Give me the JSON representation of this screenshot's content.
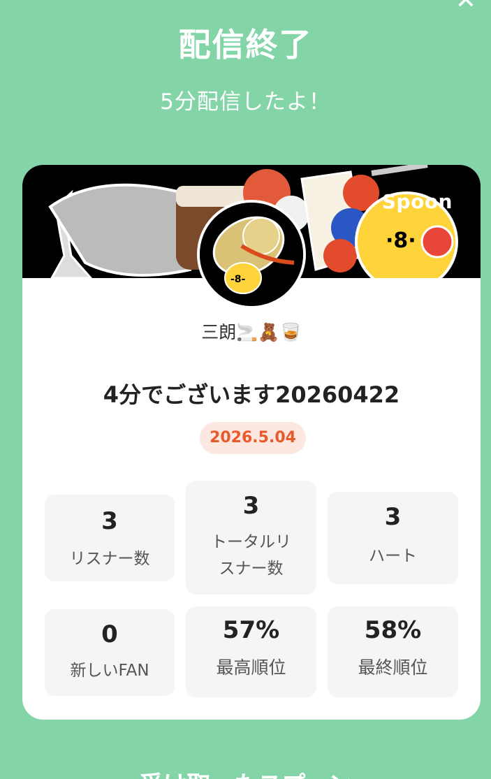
{
  "dialog": {
    "close_icon": "close-icon",
    "title": "配信終了",
    "subtitle": "5分配信したよ！"
  },
  "banner": {
    "brand": "Spoon"
  },
  "profile": {
    "name": "三朗🚬🧸🥃"
  },
  "broadcast": {
    "title": "4分でございます20260422",
    "date": "2026.5.04"
  },
  "stats": [
    {
      "value": "3",
      "label": "リスナー数"
    },
    {
      "value": "3",
      "label": "トータルリスナー数"
    },
    {
      "value": "3",
      "label": "ハート"
    },
    {
      "value": "0",
      "label": "新しいFAN"
    },
    {
      "value": "57%",
      "label": "最高順位"
    },
    {
      "value": "58%",
      "label": "最終順位"
    }
  ],
  "footer": {
    "peek_text": "受け取ったスプーン"
  },
  "colors": {
    "background": "#83d5a8",
    "accent": "#e85a2a",
    "badge_bg": "#fde8e1"
  }
}
